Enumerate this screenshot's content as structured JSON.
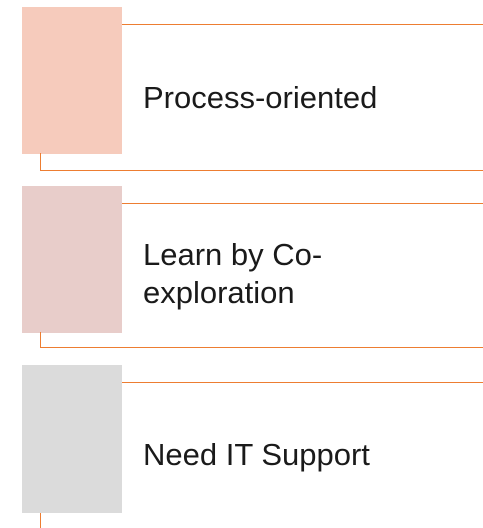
{
  "items": [
    {
      "label": "Process-oriented",
      "color": "#F6CBBC"
    },
    {
      "label": "Learn by Co-exploration",
      "color": "#E8CDCA"
    },
    {
      "label": "Need IT Support",
      "color": "#DBDBDB"
    }
  ],
  "accent_color": "#ED7D31"
}
